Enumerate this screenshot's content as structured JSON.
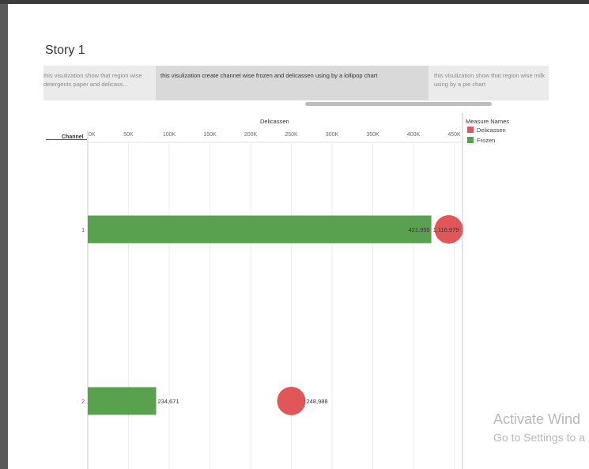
{
  "story": {
    "title": "Story 1",
    "points": [
      "this visulization show that region wise detergents paper and delicass...",
      "this visulization create channel wise frozen and delicassen using by a lollipop chart",
      "this visulization show that region wise milk using by a pie chart"
    ]
  },
  "chart_data": {
    "type": "bar",
    "title": "",
    "row_header": "Channel",
    "xlabel": "Delicassen",
    "x_ticks": [
      "0K",
      "50K",
      "100K",
      "150K",
      "200K",
      "250K",
      "300K",
      "350K",
      "400K",
      "450K"
    ],
    "xlim": [
      0,
      460000
    ],
    "categories": [
      "1",
      "2"
    ],
    "series": [
      {
        "name": "Frozen",
        "values": [
          421955,
          84000
        ],
        "labels": [
          "421,955",
          "234,671"
        ],
        "mark": "bar",
        "color": "#59a14f"
      },
      {
        "name": "Delicassen",
        "values": [
          421955,
          250000
        ],
        "labels": [
          "1,116,979",
          "248,988"
        ],
        "mark": "circle",
        "color": "#e15759"
      }
    ],
    "legend": {
      "title": "Measure Names",
      "position": "right",
      "entries": [
        "Delicassen",
        "Frozen"
      ]
    },
    "grid": true
  },
  "watermark": {
    "line1": "Activate Wind",
    "line2": "Go to Settings to a"
  }
}
